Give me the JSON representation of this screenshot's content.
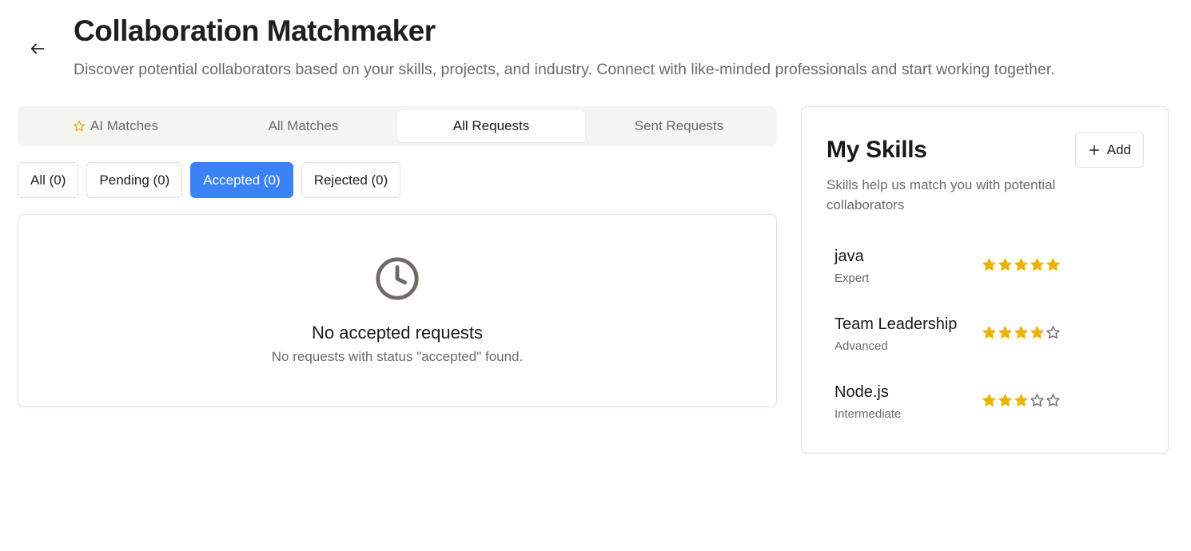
{
  "header": {
    "title": "Collaboration Matchmaker",
    "subtitle": "Discover potential collaborators based on your skills, projects, and industry. Connect with like-minded professionals and start working together."
  },
  "tabs": [
    {
      "label": "AI Matches",
      "icon": "star-outline-icon",
      "active": false
    },
    {
      "label": "All Matches",
      "active": false
    },
    {
      "label": "All Requests",
      "active": true
    },
    {
      "label": "Sent Requests",
      "active": false
    }
  ],
  "filters": [
    {
      "label": "All (0)",
      "active": false
    },
    {
      "label": "Pending (0)",
      "active": false
    },
    {
      "label": "Accepted (0)",
      "active": true
    },
    {
      "label": "Rejected (0)",
      "active": false
    }
  ],
  "empty_state": {
    "icon": "clock-icon",
    "title": "No accepted requests",
    "message": "No requests with status \"accepted\" found."
  },
  "skills": {
    "title": "My Skills",
    "add_label": "Add",
    "description": "Skills help us match you with potential collaborators",
    "items": [
      {
        "name": "java",
        "level": "Expert",
        "rating": 5,
        "max_rating": 5
      },
      {
        "name": "Team Leadership",
        "level": "Advanced",
        "rating": 4,
        "max_rating": 5
      },
      {
        "name": "Node.js",
        "level": "Intermediate",
        "rating": 3,
        "max_rating": 5
      }
    ]
  },
  "colors": {
    "accent": "#3b82f6",
    "star_filled": "#eab308",
    "star_empty": "#6f6a66",
    "muted_text": "#6f6a66",
    "border": "#e3e1df"
  }
}
